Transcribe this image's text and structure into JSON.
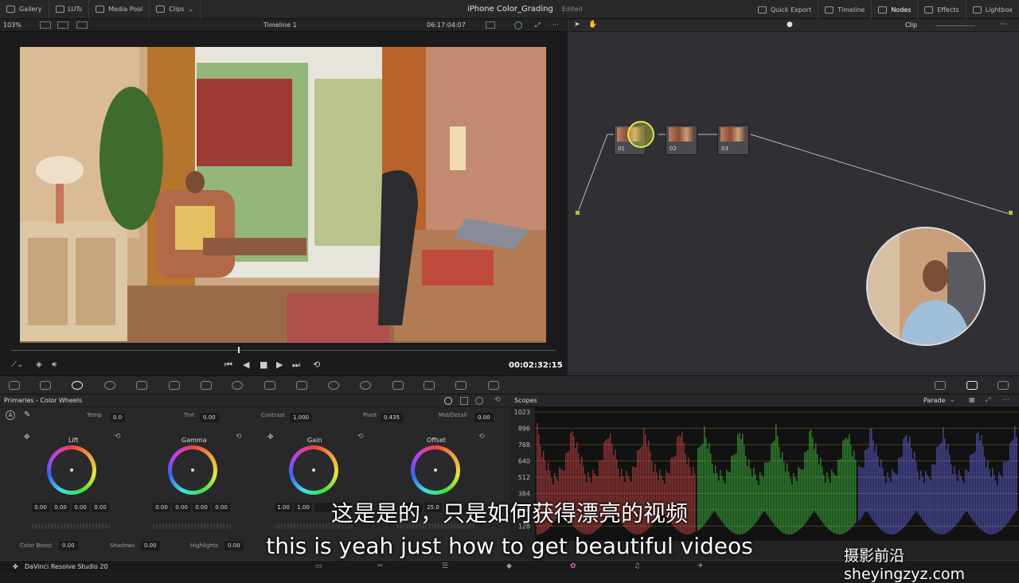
{
  "topbar": {
    "items": [
      "Gallery",
      "LUTs",
      "Media Pool",
      "Clips"
    ],
    "project_title": "iPhone Color_Grading",
    "status": "Edited",
    "right_items": [
      "Quick Export",
      "Timeline",
      "Nodes",
      "Effects",
      "Lightbox"
    ]
  },
  "viewer": {
    "zoom": "103%",
    "timeline_name": "Timeline 1",
    "source_timecode": "06:17:04:07",
    "playhead_timecode": "00:02:32:15"
  },
  "node_editor": {
    "mode_label": "Clip",
    "nodes": [
      "01",
      "02",
      "03"
    ]
  },
  "primaries": {
    "title": "Primaries - Color Wheels",
    "params": [
      {
        "label": "Temp",
        "value": "0.0"
      },
      {
        "label": "Tint",
        "value": "0.00"
      },
      {
        "label": "Contrast",
        "value": "1.000"
      },
      {
        "label": "Pivot",
        "value": "0.435"
      },
      {
        "label": "Mid/Detail",
        "value": "0.00"
      }
    ],
    "wheels": [
      {
        "name": "Lift",
        "values": [
          "0.00",
          "0.00",
          "0.00",
          "0.00"
        ]
      },
      {
        "name": "Gamma",
        "values": [
          "0.00",
          "0.00",
          "0.00",
          "0.00"
        ]
      },
      {
        "name": "Gain",
        "values": [
          "1.00",
          "1.00",
          "",
          ""
        ]
      },
      {
        "name": "Offset",
        "values": [
          "",
          "25.0",
          "",
          ""
        ]
      }
    ],
    "footer": [
      {
        "label": "Color Boost",
        "value": "0.00"
      },
      {
        "label": "Shadows",
        "value": "0.00"
      },
      {
        "label": "Highlights",
        "value": "0.00"
      }
    ]
  },
  "scopes": {
    "title": "Scopes",
    "mode": "Parade",
    "scale": [
      "1023",
      "896",
      "768",
      "640",
      "512",
      "384",
      "256",
      "128"
    ]
  },
  "status": {
    "app_name": "DaVinci Resolve Studio 20"
  },
  "subtitles": {
    "cn": "这是是的，只是如何获得漂亮的视频",
    "en": "this is yeah just how to get beautiful videos"
  },
  "watermark": "摄影前沿 sheyingzyz.com",
  "colors": {
    "accent": "#e5e54a",
    "red_channel": "#e04848",
    "green_channel": "#44d044",
    "blue_channel": "#6a6af0"
  }
}
